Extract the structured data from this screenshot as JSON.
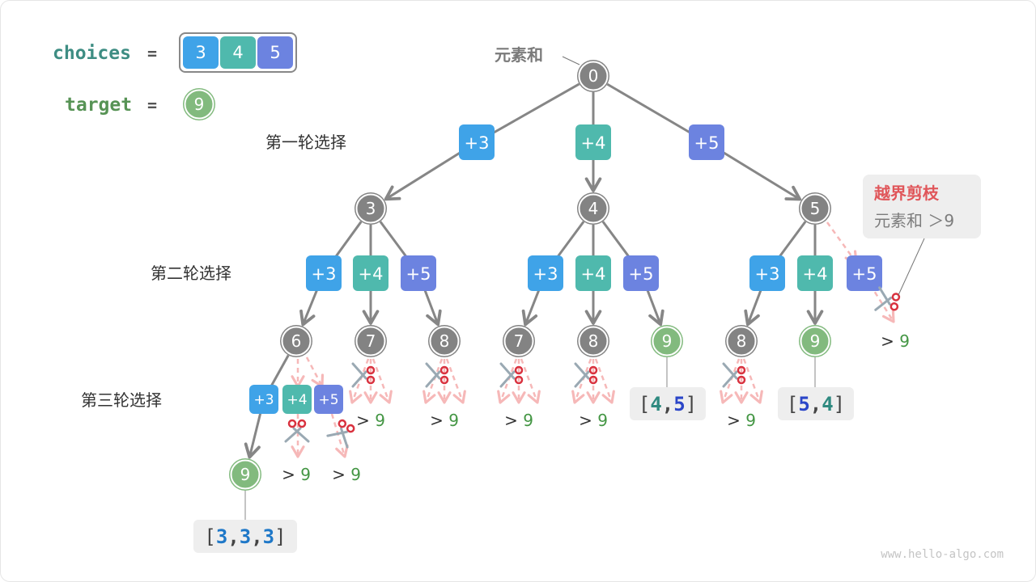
{
  "colors": {
    "c3": "#3fa3e8",
    "c4": "#4fb9ad",
    "c5": "#6c83e0",
    "node_gray": "#838383",
    "node_green": "#82ba7e",
    "edge": "#868686",
    "pruned_edge": "#f6b8b8",
    "label_teal": "#3e8d83",
    "label_green": "#579355",
    "prune_title": "#e0565a",
    "note_bg": "#eeeeee",
    "green_text": "#449644",
    "watermark": "#c4c4c4"
  },
  "legend": {
    "choices_label": "choices",
    "equals": "=",
    "choices": [
      "3",
      "4",
      "5"
    ],
    "target_label": "target",
    "target_value": "9"
  },
  "root_caption": "元素和",
  "round_labels": [
    "第一轮选择",
    "第二轮选择",
    "第三轮选择"
  ],
  "prune_note": {
    "title": "越界剪枝",
    "subtitle": "元素和 ＞9"
  },
  "exceed_label": {
    "gt": ">",
    "num": "9"
  },
  "nodes": [
    {
      "id": "root",
      "value": "0",
      "status": "normal"
    },
    {
      "id": "n3",
      "value": "3",
      "status": "normal"
    },
    {
      "id": "n4",
      "value": "4",
      "status": "normal"
    },
    {
      "id": "n5",
      "value": "5",
      "status": "normal"
    },
    {
      "id": "n33",
      "value": "6",
      "status": "normal"
    },
    {
      "id": "n34",
      "value": "7",
      "status": "normal"
    },
    {
      "id": "n35",
      "value": "8",
      "status": "normal"
    },
    {
      "id": "n43",
      "value": "7",
      "status": "normal"
    },
    {
      "id": "n44",
      "value": "8",
      "status": "normal"
    },
    {
      "id": "n45",
      "value": "9",
      "status": "solution"
    },
    {
      "id": "n53",
      "value": "8",
      "status": "normal"
    },
    {
      "id": "n54",
      "value": "9",
      "status": "solution"
    },
    {
      "id": "n333",
      "value": "9",
      "status": "solution"
    }
  ],
  "choice_boxes": [
    {
      "id": "b_r3",
      "label": "+3",
      "kind": "c3"
    },
    {
      "id": "b_r4",
      "label": "+4",
      "kind": "c4"
    },
    {
      "id": "b_r5",
      "label": "+5",
      "kind": "c5"
    },
    {
      "id": "b_33",
      "label": "+3",
      "kind": "c3"
    },
    {
      "id": "b_34",
      "label": "+4",
      "kind": "c4"
    },
    {
      "id": "b_35",
      "label": "+5",
      "kind": "c5"
    },
    {
      "id": "b_43",
      "label": "+3",
      "kind": "c3"
    },
    {
      "id": "b_44",
      "label": "+4",
      "kind": "c4"
    },
    {
      "id": "b_45",
      "label": "+5",
      "kind": "c5"
    },
    {
      "id": "b_53",
      "label": "+3",
      "kind": "c3"
    },
    {
      "id": "b_54",
      "label": "+4",
      "kind": "c4"
    },
    {
      "id": "b_55",
      "label": "+5",
      "kind": "c5"
    },
    {
      "id": "b_333",
      "label": "+3",
      "kind": "c3"
    },
    {
      "id": "b_334",
      "label": "+4",
      "kind": "c4"
    },
    {
      "id": "b_335",
      "label": "+5",
      "kind": "c5"
    }
  ],
  "solutions": [
    {
      "id": "s1",
      "items": [
        {
          "v": "3",
          "kind": "c3"
        },
        {
          "v": "3",
          "kind": "c3"
        },
        {
          "v": "3",
          "kind": "c3"
        }
      ]
    },
    {
      "id": "s2",
      "items": [
        {
          "v": "4",
          "kind": "c4"
        },
        {
          "v": "5",
          "kind": "c5"
        }
      ]
    },
    {
      "id": "s3",
      "items": [
        {
          "v": "5",
          "kind": "c5"
        },
        {
          "v": "4",
          "kind": "c4"
        }
      ]
    }
  ],
  "watermark": "www.hello-algo.com"
}
